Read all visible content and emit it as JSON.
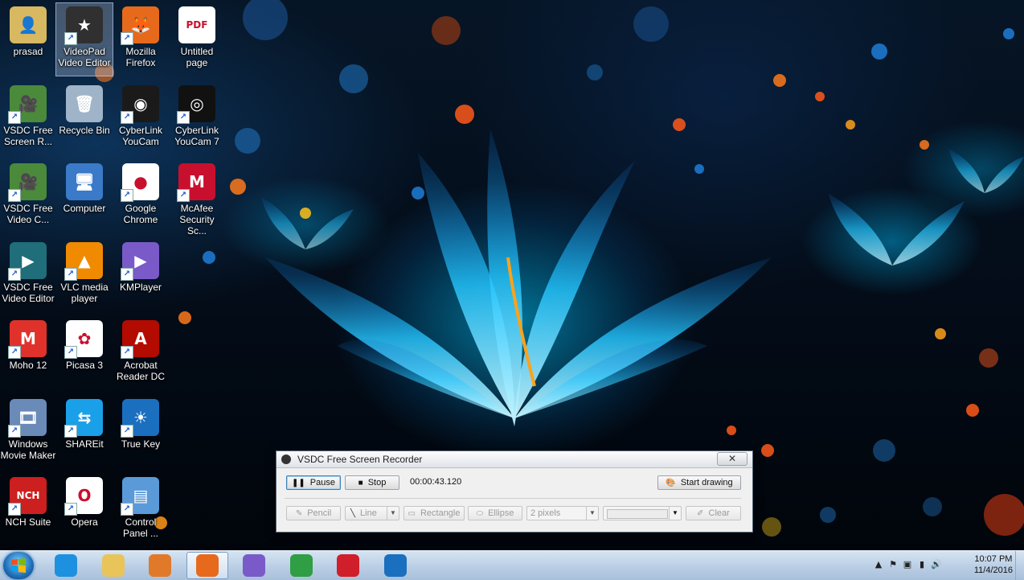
{
  "desktop_icons": [
    {
      "id": "prasad",
      "label": "prasad",
      "color": "#d8b860",
      "glyph": "👤",
      "shortcut": false,
      "col": 0,
      "row": 0
    },
    {
      "id": "videopad",
      "label": "VideoPad Video Editor",
      "color": "#303030",
      "glyph": "★",
      "shortcut": true,
      "col": 1,
      "row": 0,
      "selected": true
    },
    {
      "id": "firefox",
      "label": "Mozilla Firefox",
      "color": "#e76a1c",
      "glyph": "🦊",
      "shortcut": true,
      "col": 2,
      "row": 0
    },
    {
      "id": "untitled",
      "label": "Untitled page",
      "color": "#ffffff",
      "glyph": "PDF",
      "shortcut": false,
      "col": 3,
      "row": 0
    },
    {
      "id": "vsdc-rec",
      "label": "VSDC Free Screen R...",
      "color": "#4a8a3a",
      "glyph": "🎥",
      "shortcut": true,
      "col": 0,
      "row": 1
    },
    {
      "id": "recycle",
      "label": "Recycle Bin",
      "color": "#9fb4c8",
      "glyph": "🗑",
      "shortcut": false,
      "col": 1,
      "row": 1
    },
    {
      "id": "youcam",
      "label": "CyberLink YouCam",
      "color": "#1a1a1a",
      "glyph": "◉",
      "shortcut": true,
      "col": 2,
      "row": 1
    },
    {
      "id": "youcam7",
      "label": "CyberLink YouCam 7",
      "color": "#111111",
      "glyph": "◎",
      "shortcut": true,
      "col": 3,
      "row": 1
    },
    {
      "id": "vsdc-vc",
      "label": "VSDC Free Video C...",
      "color": "#4a8a3a",
      "glyph": "🎥",
      "shortcut": true,
      "col": 0,
      "row": 2
    },
    {
      "id": "computer",
      "label": "Computer",
      "color": "#3a7ac8",
      "glyph": "🖥",
      "shortcut": false,
      "col": 1,
      "row": 2
    },
    {
      "id": "chrome",
      "label": "Google Chrome",
      "color": "#ffffff",
      "glyph": "●",
      "shortcut": true,
      "col": 2,
      "row": 2
    },
    {
      "id": "mcafee",
      "label": "McAfee Security Sc...",
      "color": "#c8102e",
      "glyph": "M",
      "shortcut": true,
      "col": 3,
      "row": 2
    },
    {
      "id": "vsdc-ve",
      "label": "VSDC Free Video Editor",
      "color": "#1f6e7a",
      "glyph": "▶",
      "shortcut": true,
      "col": 0,
      "row": 3
    },
    {
      "id": "vlc",
      "label": "VLC media player",
      "color": "#f08a00",
      "glyph": "▲",
      "shortcut": true,
      "col": 1,
      "row": 3
    },
    {
      "id": "kmplayer",
      "label": "KMPlayer",
      "color": "#7a5ac8",
      "glyph": "▶",
      "shortcut": true,
      "col": 2,
      "row": 3
    },
    {
      "id": "moho",
      "label": "Moho 12",
      "color": "#e0322b",
      "glyph": "M",
      "shortcut": true,
      "col": 0,
      "row": 4
    },
    {
      "id": "picasa",
      "label": "Picasa 3",
      "color": "#ffffff",
      "glyph": "✿",
      "shortcut": true,
      "col": 1,
      "row": 4
    },
    {
      "id": "acrobat",
      "label": "Acrobat Reader DC",
      "color": "#b30b00",
      "glyph": "A",
      "shortcut": true,
      "col": 2,
      "row": 4
    },
    {
      "id": "moviemaker",
      "label": "Windows Movie Maker",
      "color": "#6a8ab8",
      "glyph": "🎞",
      "shortcut": true,
      "col": 0,
      "row": 5
    },
    {
      "id": "shareit",
      "label": "SHAREit",
      "color": "#1aa0e8",
      "glyph": "⇆",
      "shortcut": true,
      "col": 1,
      "row": 5
    },
    {
      "id": "truekey",
      "label": "True Key",
      "color": "#1b6fbf",
      "glyph": "☀",
      "shortcut": true,
      "col": 2,
      "row": 5
    },
    {
      "id": "nch",
      "label": "NCH Suite",
      "color": "#cc1f1f",
      "glyph": "NCH",
      "shortcut": true,
      "col": 0,
      "row": 6
    },
    {
      "id": "opera",
      "label": "Opera",
      "color": "#ffffff",
      "glyph": "O",
      "shortcut": true,
      "col": 1,
      "row": 6
    },
    {
      "id": "controlpanel",
      "label": "Control Panel ...",
      "color": "#5a9ad8",
      "glyph": "▤",
      "shortcut": true,
      "col": 2,
      "row": 6
    }
  ],
  "recorder": {
    "title": "VSDC Free Screen Recorder",
    "close_label": "✕",
    "pause_label": "Pause",
    "stop_label": "Stop",
    "timer": "00:00:43.120",
    "start_drawing_label": "Start drawing",
    "pencil_label": "Pencil",
    "line_label": "Line",
    "rectangle_label": "Rectangle",
    "ellipse_label": "Ellipse",
    "thickness_value": "2 pixels",
    "clear_label": "Clear"
  },
  "taskbar": {
    "apps": [
      {
        "id": "ie",
        "color": "#1e90e0",
        "active": false
      },
      {
        "id": "explorer",
        "color": "#e8c45a",
        "active": false
      },
      {
        "id": "media",
        "color": "#e07a2a",
        "active": false
      },
      {
        "id": "firefox",
        "color": "#e76a1c",
        "active": true
      },
      {
        "id": "kmplayer",
        "color": "#7a5ac8",
        "active": false
      },
      {
        "id": "chrome",
        "color": "#2f9e44",
        "active": false
      },
      {
        "id": "opera",
        "color": "#d01e2a",
        "active": false
      },
      {
        "id": "truekey",
        "color": "#1b6fbf",
        "active": false
      }
    ],
    "clock_time": "10:07 PM",
    "clock_date": "11/4/2016"
  }
}
